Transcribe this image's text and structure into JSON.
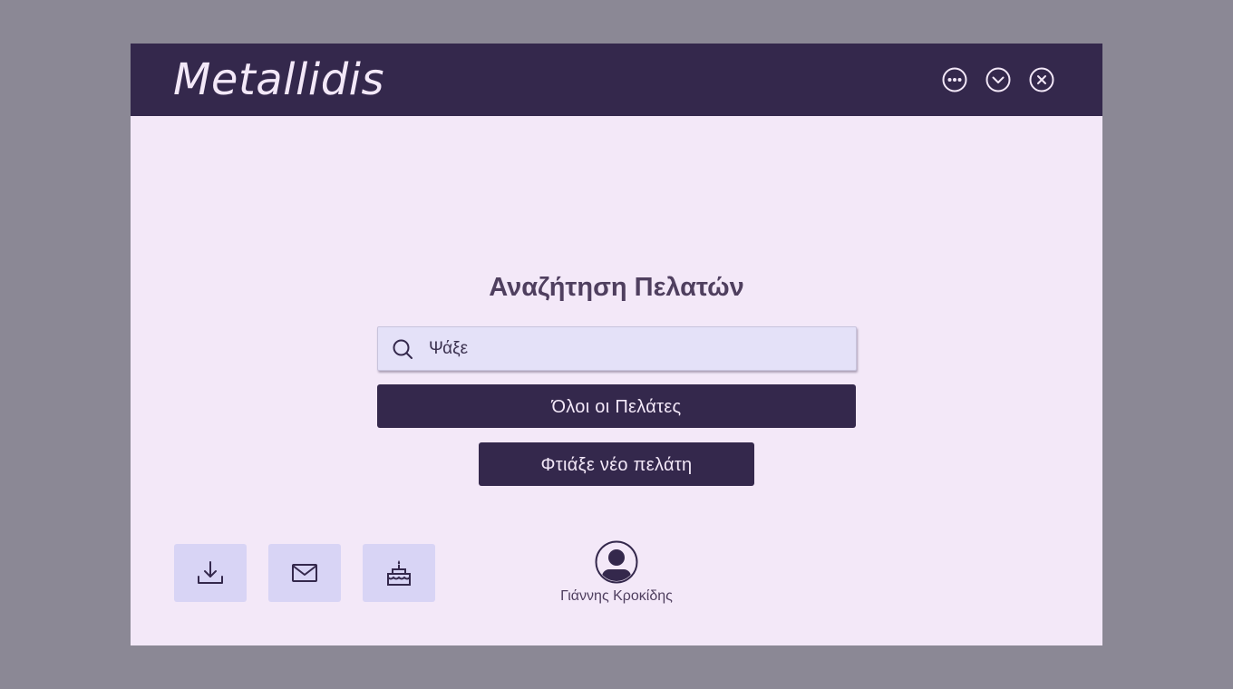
{
  "app": {
    "title": "Metallidis"
  },
  "titlebar": {
    "buttons": [
      {
        "name": "more-options",
        "icon": "ellipsis-circle-icon"
      },
      {
        "name": "minimize",
        "icon": "chevron-down-circle-icon"
      },
      {
        "name": "close",
        "icon": "close-circle-icon"
      }
    ]
  },
  "main": {
    "heading": "Αναζήτηση Πελατών",
    "search": {
      "placeholder": "Ψάξε",
      "value": "",
      "icon": "search-icon"
    },
    "all_customers_label": "Όλοι οι Πελάτες",
    "new_customer_label": "Φτιάξε νέο πελάτη"
  },
  "footer": {
    "tiles": [
      {
        "name": "download",
        "icon": "download-icon"
      },
      {
        "name": "mail",
        "icon": "mail-icon"
      },
      {
        "name": "birthday",
        "icon": "cake-icon"
      }
    ],
    "user": {
      "name": "Γιάννης Κροκίδης",
      "icon": "user-circle-icon"
    }
  },
  "colors": {
    "background": "#8b8895",
    "titlebar": "#34284c",
    "window": "#f3e8f8",
    "primary_button": "#34284c",
    "search_field": "#e4e1f8",
    "tile": "#d8d4f5",
    "heading_text": "#4f3f5f"
  }
}
